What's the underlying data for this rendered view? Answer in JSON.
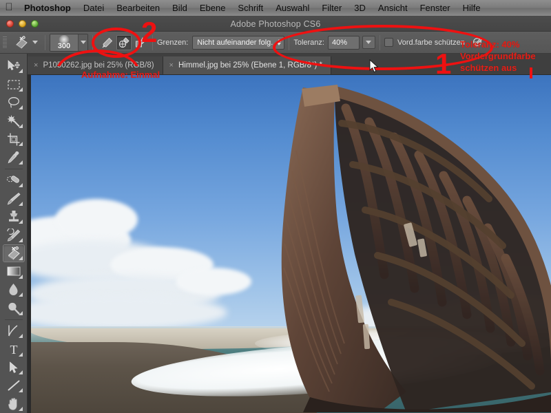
{
  "menubar": {
    "apple_icon": "apple-logo",
    "items": [
      {
        "label": "Photoshop",
        "bold": true
      },
      {
        "label": "Datei",
        "bold": false
      },
      {
        "label": "Bearbeiten",
        "bold": false
      },
      {
        "label": "Bild",
        "bold": false
      },
      {
        "label": "Ebene",
        "bold": false
      },
      {
        "label": "Schrift",
        "bold": false
      },
      {
        "label": "Auswahl",
        "bold": false
      },
      {
        "label": "Filter",
        "bold": false
      },
      {
        "label": "3D",
        "bold": false
      },
      {
        "label": "Ansicht",
        "bold": false
      },
      {
        "label": "Fenster",
        "bold": false
      },
      {
        "label": "Hilfe",
        "bold": false
      }
    ]
  },
  "window": {
    "title": "Adobe Photoshop CS6",
    "close_label": "close",
    "minimize_label": "minimize",
    "zoom_label": "zoom"
  },
  "options_bar": {
    "tool_preset_icon": "background-eraser-icon",
    "brush_size": "300",
    "sampling_modes": [
      {
        "name": "sampling-continuous",
        "active": false
      },
      {
        "name": "sampling-once",
        "active": true
      },
      {
        "name": "sampling-background-swatch",
        "active": false
      }
    ],
    "limits_label": "Grenzen:",
    "limits_value": "Nicht aufeinander folg.",
    "tolerance_label": "Toleranz:",
    "tolerance_value": "40%",
    "protect_foreground_label": "Vord.farbe schützen",
    "protect_foreground_checked": false,
    "pressure_icon": "airbrush-pressure-icon"
  },
  "tabs": [
    {
      "label": "P1050262.jpg bei 25% (RGB/8)",
      "active": false,
      "close": "×"
    },
    {
      "label": "Himmel.jpg bei 25% (Ebene 1, RGB/8*) *",
      "active": true,
      "close": "×"
    }
  ],
  "toolbar": {
    "tools": [
      {
        "name": "move-tool",
        "active": false
      },
      {
        "name": "rectangular-marquee-tool",
        "active": false
      },
      {
        "name": "lasso-tool",
        "active": false
      },
      {
        "name": "magic-wand-tool",
        "active": false
      },
      {
        "name": "crop-tool",
        "active": false
      },
      {
        "name": "eyedropper-tool",
        "active": false
      },
      {
        "name": "spot-healing-brush-tool",
        "active": false
      },
      {
        "name": "brush-tool",
        "active": false
      },
      {
        "name": "clone-stamp-tool",
        "active": false
      },
      {
        "name": "history-brush-tool",
        "active": false
      },
      {
        "name": "background-eraser-tool",
        "active": true
      },
      {
        "name": "gradient-tool",
        "active": false
      },
      {
        "name": "blur-tool",
        "active": false
      },
      {
        "name": "dodge-tool",
        "active": false
      },
      {
        "name": "pen-tool",
        "active": false
      },
      {
        "name": "horizontal-type-tool",
        "active": false
      },
      {
        "name": "path-selection-tool",
        "active": false
      },
      {
        "name": "line-shape-tool",
        "active": false
      },
      {
        "name": "hand-tool",
        "active": false
      }
    ]
  },
  "annotations": {
    "number_one": "1",
    "number_two": "2",
    "tolerance_note_line1": "Toleranz: 40%",
    "tolerance_note_line2": "Vordergrundfarbe",
    "tolerance_note_line3": "schützen aus",
    "sampling_note": "Aufnahme: Einmal",
    "highlight_color": "#ee1111"
  },
  "canvas": {
    "subject": "shipwreck-photo",
    "description": "Rostiges Schiffswrack am Strand vor blauem Himmel"
  }
}
